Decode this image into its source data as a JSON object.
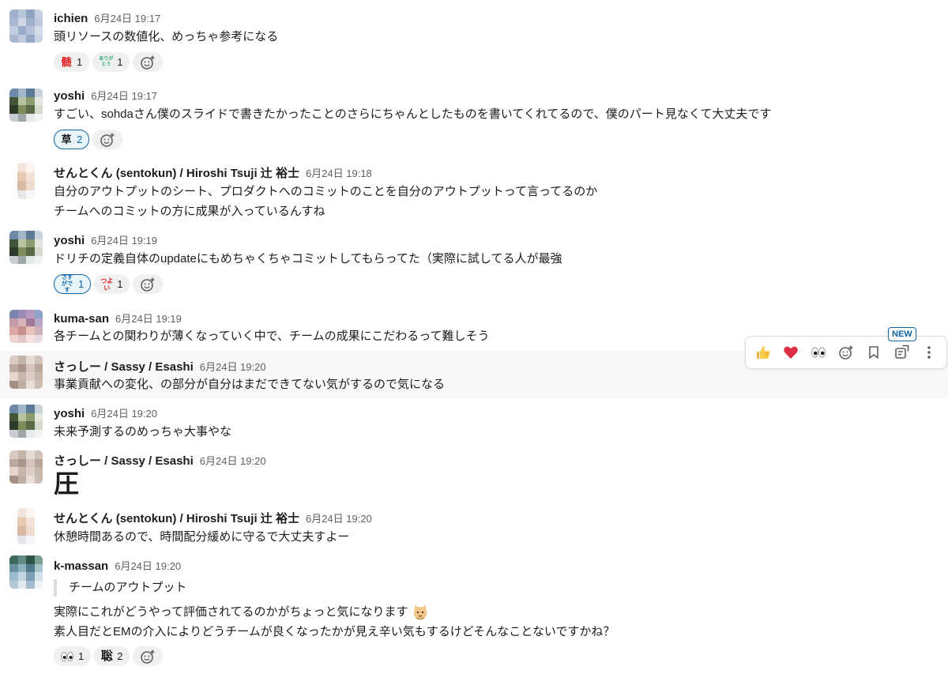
{
  "colors": {
    "accent": "#1264a3",
    "hover_bg": "#f8f8f8",
    "reaction_bg": "#f0f0f0"
  },
  "messages": [
    {
      "name": "ichien",
      "time": "6月24日 19:17",
      "lines": [
        "頭リソースの数値化、めっちゃ参考になる"
      ],
      "reactions": [
        {
          "emoji": "髄",
          "count": "1"
        },
        {
          "emoji": "ありがとう",
          "count": "1"
        }
      ]
    },
    {
      "name": "yoshi",
      "time": "6月24日 19:17",
      "lines": [
        "すごい、sohdaさん僕のスライドで書きたかったことのさらにちゃんとしたものを書いてくれてるので、僕のパート見なくて大丈夫です"
      ],
      "reactions": [
        {
          "emoji": "草",
          "count": "2"
        }
      ]
    },
    {
      "name": "せんとくん (sentokun) / Hiroshi Tsuji 辻 裕士",
      "time": "6月24日 19:18",
      "lines": [
        "自分のアウトプットのシート、プロダクトへのコミットのことを自分のアウトプットって言ってるのか",
        "チームへのコミットの方に成果が入っているんすね"
      ]
    },
    {
      "name": "yoshi",
      "time": "6月24日 19:19",
      "lines": [
        "ドリチの定義自体のupdateにもめちゃくちゃコミットしてもらってた（実際に試してる人が最強"
      ],
      "reactions": [
        {
          "emoji": "さすがです",
          "count": "1"
        },
        {
          "emoji": "つよい",
          "count": "1"
        }
      ]
    },
    {
      "name": "kuma-san",
      "time": "6月24日 19:19",
      "lines": [
        "各チームとの関わりが薄くなっていく中で、チームの成果にこだわるって難しそう"
      ]
    },
    {
      "name": "さっしー / Sassy / Esashi",
      "time": "6月24日 19:20",
      "lines": [
        "事業貢献への変化、の部分が自分はまだできてない気がするので気になる"
      ]
    },
    {
      "name": "yoshi",
      "time": "6月24日 19:20",
      "lines": [
        "未来予測するのめっちゃ大事やな"
      ]
    },
    {
      "name": "さっしー / Sassy / Esashi",
      "time": "6月24日 19:20",
      "lines": [
        "圧"
      ]
    },
    {
      "name": "せんとくん (sentokun) / Hiroshi Tsuji 辻 裕士",
      "time": "6月24日 19:20",
      "lines": [
        "休憩時間あるので、時間配分緩めに守るで大丈夫すよー"
      ]
    },
    {
      "name": "k-massan",
      "time": "6月24日 19:20",
      "quote": "チームのアウトプット",
      "lines": [
        "実際にこれがどうやって評価されてるのかがちょっと気になります",
        "素人目だとEMの介入によりどうチームが良くなったかが見え辛い気もするけどそんなことないですかね？"
      ],
      "reactions": [
        {
          "emoji": "eyes",
          "count": "1"
        },
        {
          "emoji": "聡",
          "count": "2"
        }
      ]
    }
  ],
  "toolbar": {
    "new_badge": "NEW",
    "icons": [
      "thumbsup-icon",
      "heart-icon",
      "eyes-icon",
      "add-reaction-icon",
      "bookmark-icon",
      "reminder-icon",
      "more-icon"
    ]
  }
}
